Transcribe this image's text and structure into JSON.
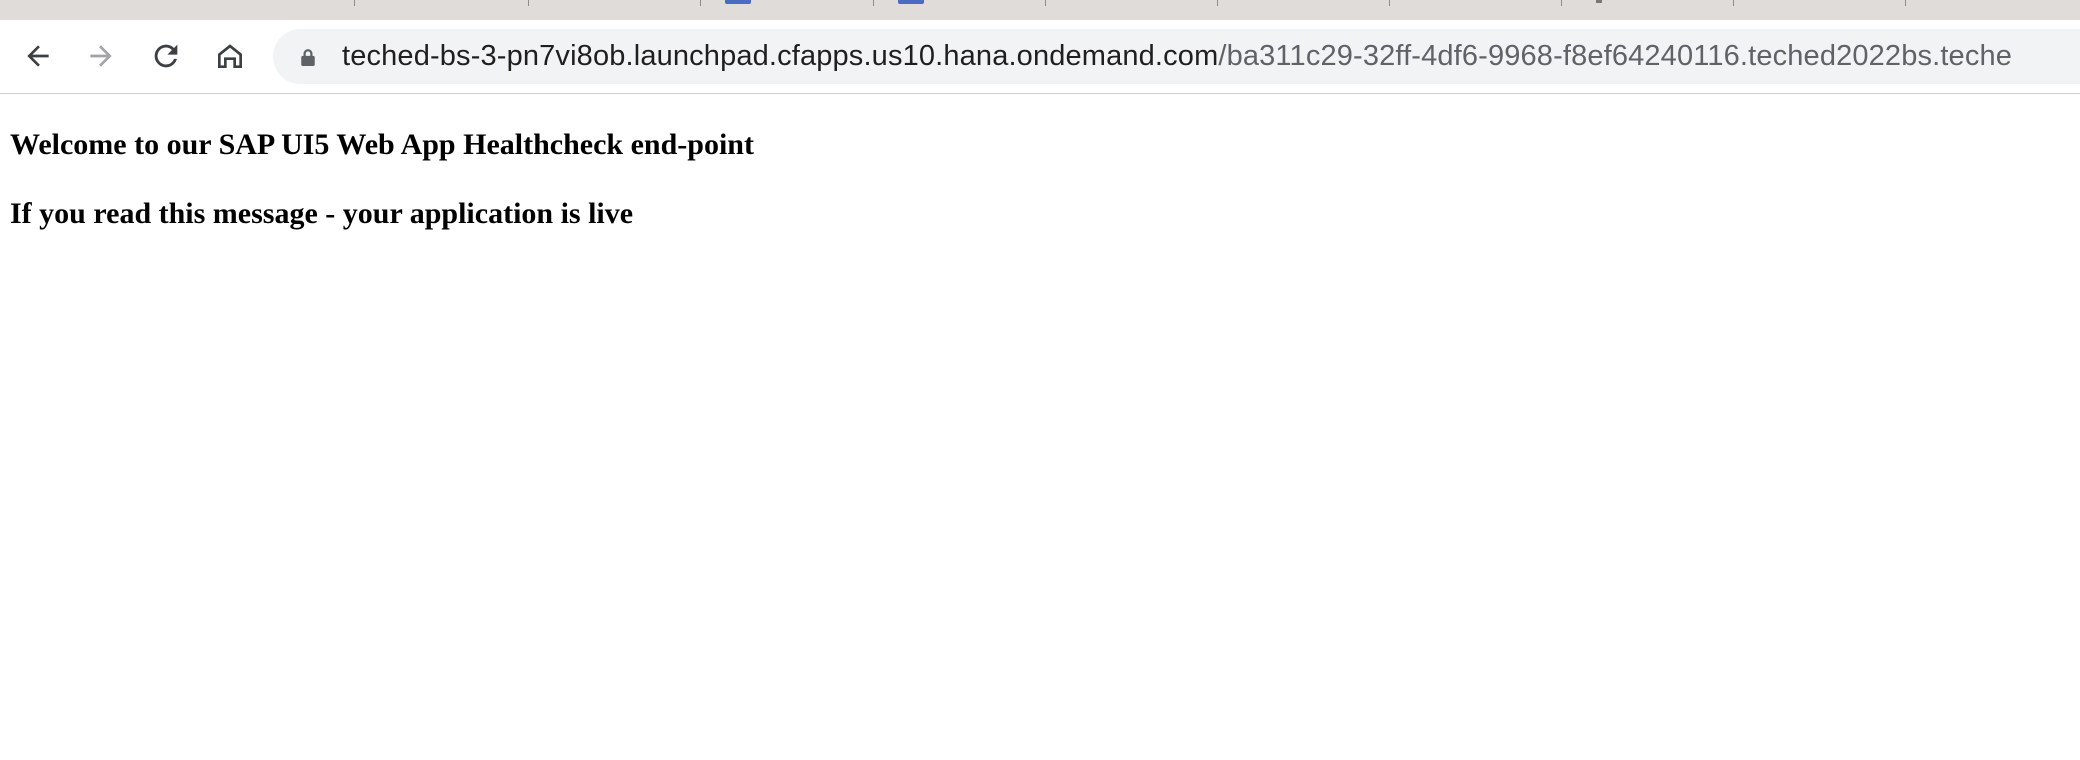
{
  "browser": {
    "address_bar": {
      "host": "teched-bs-3-pn7vi8ob.launchpad.cfapps.us10.hana.ondemand.com",
      "path": "/ba311c29-32ff-4df6-9968-f8ef64240116.teched2022bs.teche"
    },
    "toolbar": {
      "back_icon": "arrow-left-icon",
      "forward_icon": "arrow-right-icon",
      "reload_icon": "reload-icon",
      "home_icon": "home-icon",
      "lock_icon": "lock-icon"
    },
    "colors": {
      "tab_strip": "#dfdcda",
      "omnibox": "#f1f3f4",
      "url_host": "#1f1f1f",
      "url_path": "#5f6368"
    }
  },
  "page": {
    "heading_welcome": "Welcome to our SAP UI5 Web App Healthcheck end-point",
    "heading_live": "If you read this message - your application is live"
  }
}
